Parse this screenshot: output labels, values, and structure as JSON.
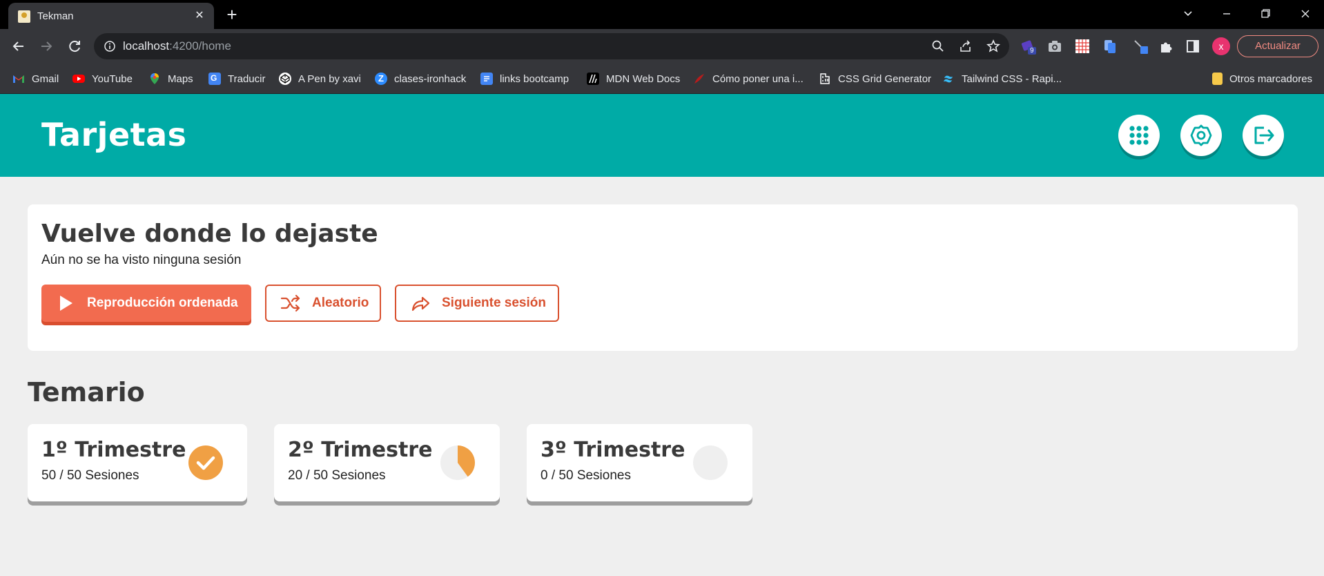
{
  "browser": {
    "tab_title": "Tekman",
    "tab_close": "✕",
    "new_tab": "+",
    "url_host": "localhost",
    "url_path": ":4200/home",
    "update_label": "Actualizar",
    "profile_initial": "x",
    "extension_badge": "9",
    "bookmarks": [
      {
        "label": "Gmail",
        "icon": "gmail-icon",
        "color": "#ea4335"
      },
      {
        "label": "YouTube",
        "icon": "youtube-icon",
        "color": "#ff0000"
      },
      {
        "label": "Maps",
        "icon": "maps-icon",
        "color": "#34a853"
      },
      {
        "label": "Traducir",
        "icon": "translate-icon",
        "color": "#4285f4"
      },
      {
        "label": "A Pen by xavi",
        "icon": "codepen-icon",
        "color": "#ffffff"
      },
      {
        "label": "clases-ironhack",
        "icon": "zoom-icon",
        "color": "#2d8cff"
      },
      {
        "label": "links bootcamp",
        "icon": "docs-icon",
        "color": "#4285f4"
      },
      {
        "label": "MDN Web Docs",
        "icon": "mdn-icon",
        "color": "#000000"
      },
      {
        "label": "Cómo poner una i...",
        "icon": "site-icon",
        "color": "#b71c1c"
      },
      {
        "label": "CSS Grid Generator",
        "icon": "grid-icon",
        "color": "#ffffff"
      },
      {
        "label": "Tailwind CSS - Rapi...",
        "icon": "tailwind-icon",
        "color": "#38bdf8"
      }
    ],
    "other_bookmarks": "Otros marcadores"
  },
  "app": {
    "title": "Tarjetas",
    "accent": "#00aba6",
    "resume": {
      "title": "Vuelve donde lo dejaste",
      "subtitle": "Aún no se ha visto ninguna sesión",
      "buttons": {
        "ordered": "Reproducción ordenada",
        "random": "Aleatorio",
        "next": "Siguiente sesión"
      }
    },
    "syllabus": {
      "title": "Temario",
      "terms": [
        {
          "title": "1º Trimestre",
          "count": "50 / 50 Sesiones",
          "progress": 1.0,
          "status": "complete"
        },
        {
          "title": "2º Trimestre",
          "count": "20 / 50 Sesiones",
          "progress": 0.4,
          "status": "in-progress"
        },
        {
          "title": "3º Trimestre",
          "count": "0 / 50 Sesiones",
          "progress": 0.0,
          "status": "not-started"
        }
      ]
    }
  }
}
